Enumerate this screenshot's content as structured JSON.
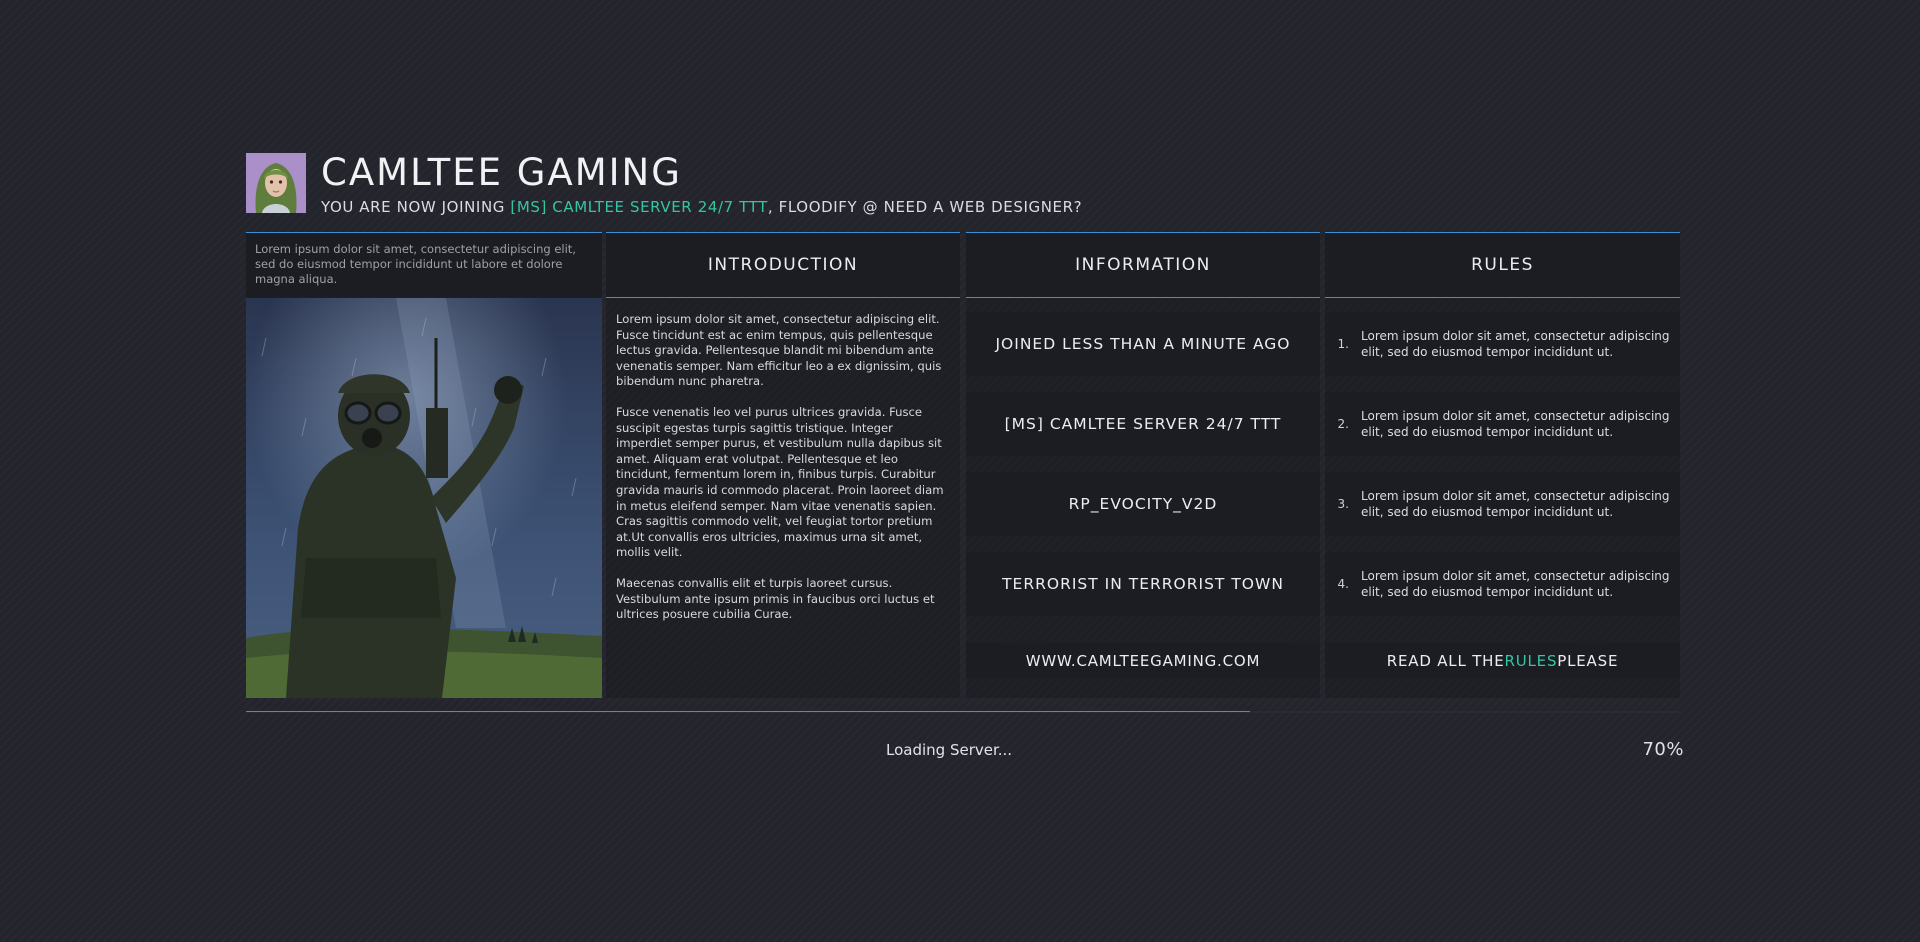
{
  "header": {
    "title": "CAMLTEE GAMING",
    "subtitle_prefix": "YOU ARE NOW JOINING ",
    "subtitle_server": "[MS] CAMLTEE SERVER 24/7 TTT",
    "subtitle_suffix": ", FLOODIFY @ NEED A WEB DESIGNER?"
  },
  "media": {
    "caption": "Lorem ipsum dolor sit amet, consectetur adipiscing elit, sed do eiusmod tempor incididunt ut labore et dolore magna aliqua."
  },
  "introduction": {
    "title": "INTRODUCTION",
    "paragraphs": [
      "Lorem ipsum dolor sit amet, consectetur adipiscing elit. Fusce tincidunt est ac enim tempus, quis pellentesque lectus gravida. Pellentesque blandit mi bibendum ante venenatis semper. Nam efficitur leo a ex dignissim, quis bibendum nunc pharetra.",
      "Fusce venenatis leo vel purus ultrices gravida. Fusce suscipit egestas turpis sagittis tristique. Integer imperdiet semper purus, et vestibulum nulla dapibus sit amet. Aliquam erat volutpat. Pellentesque et leo tincidunt, fermentum lorem in, finibus turpis. Curabitur gravida mauris id commodo placerat. Proin laoreet diam in metus eleifend semper. Nam vitae venenatis sapien. Cras sagittis commodo velit, vel feugiat tortor pretium at.Ut convallis eros ultricies, maximus urna sit amet, mollis velit.",
      "Maecenas convallis elit et turpis laoreet cursus. Vestibulum ante ipsum primis in faucibus orci luctus et ultrices posuere cubilia Curae."
    ]
  },
  "information": {
    "title": "INFORMATION",
    "items": [
      "JOINED LESS THAN A MINUTE AGO",
      "[MS] CAMLTEE SERVER 24/7 TTT",
      "RP_EVOCITY_V2D",
      "TERRORIST IN TERRORIST TOWN"
    ],
    "website": "WWW.CAMLTEEGAMING.COM"
  },
  "rules": {
    "title": "RULES",
    "items": [
      {
        "num": "1.",
        "text": "Lorem ipsum dolor sit amet, consectetur adipiscing elit, sed do eiusmod tempor incididunt ut."
      },
      {
        "num": "2.",
        "text": "Lorem ipsum dolor sit amet, consectetur adipiscing elit, sed do eiusmod tempor incididunt ut."
      },
      {
        "num": "3.",
        "text": "Lorem ipsum dolor sit amet, consectetur adipiscing elit, sed do eiusmod tempor incididunt ut."
      },
      {
        "num": "4.",
        "text": "Lorem ipsum dolor sit amet, consectetur adipiscing elit, sed do eiusmod tempor incididunt ut."
      }
    ],
    "footer_prefix": "READ ALL THE ",
    "footer_highlight": "RULES",
    "footer_suffix": " PLEASE"
  },
  "loading": {
    "status": "Loading Server...",
    "percent_label": "70%",
    "progress_fraction": 0.7
  },
  "colors": {
    "accent": "#34c6a4",
    "line": "#3d8fd8",
    "background": "#24252c",
    "panel": "#1c1d23"
  },
  "icons": {
    "avatar": "player-avatar-image",
    "media": "soldier-screenshot-image"
  }
}
